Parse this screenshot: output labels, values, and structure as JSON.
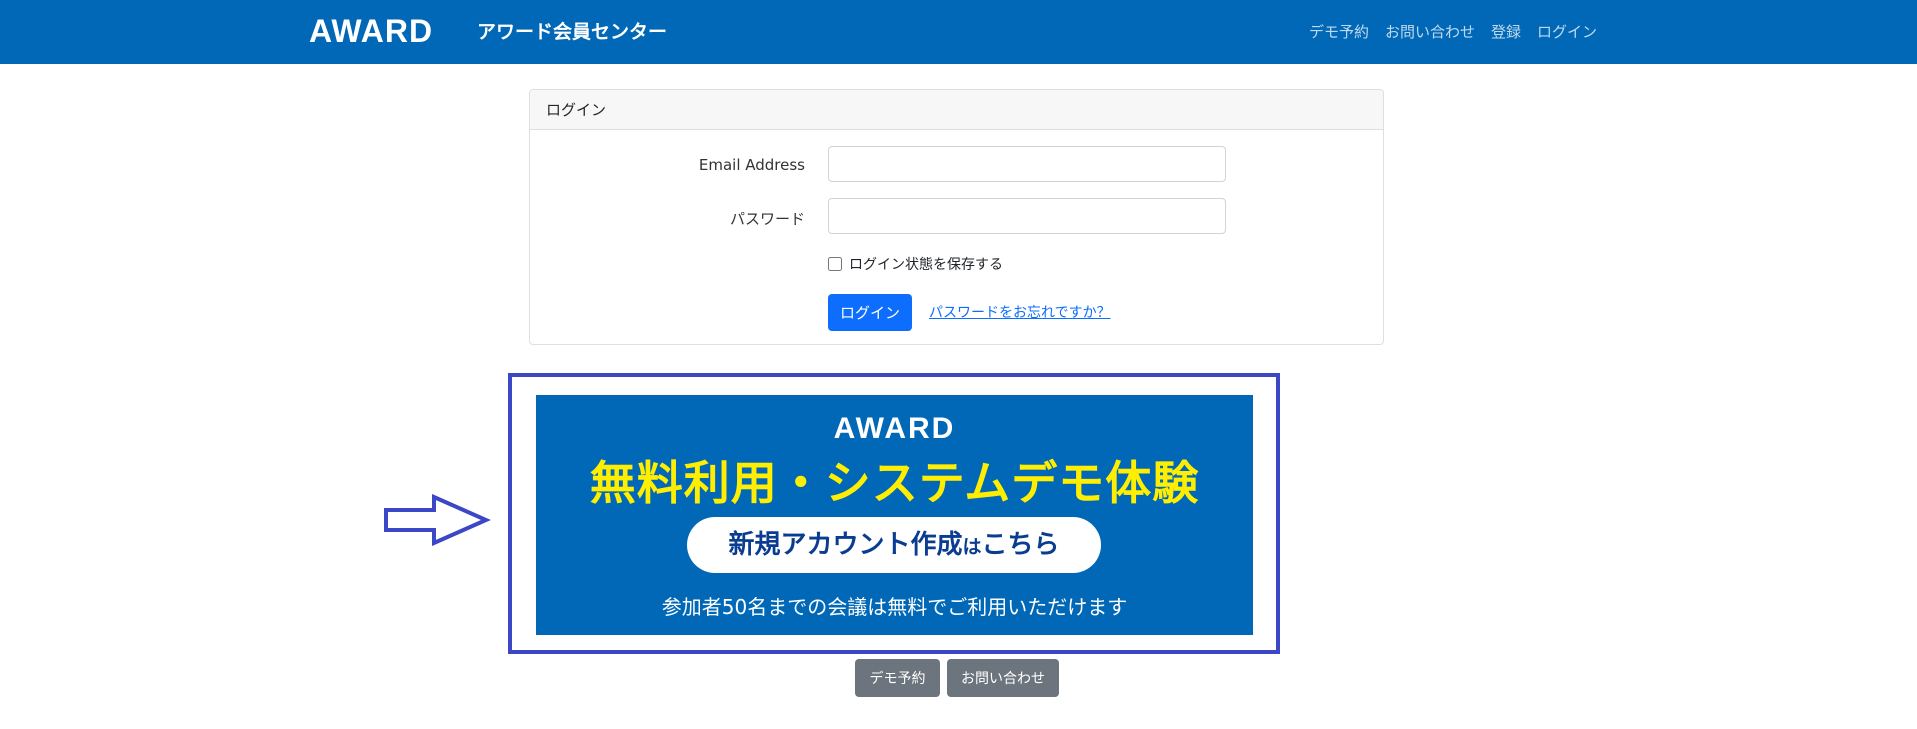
{
  "navbar": {
    "logo": "AWARD",
    "title": "アワード会員センター",
    "links": [
      "デモ予約",
      "お問い合わせ",
      "登録",
      "ログイン"
    ]
  },
  "login_card": {
    "header": "ログイン",
    "email_label": "Email Address",
    "email_value": "",
    "password_label": "パスワード",
    "password_value": "",
    "remember_label": "ログイン状態を保存する",
    "login_button": "ログイン",
    "forgot_link": "パスワードをお忘れですか？"
  },
  "banner": {
    "logo": "AWARD",
    "headline": "無料利用・システムデモ体験",
    "pill_main": "新規アカウント作成",
    "pill_small": "は",
    "pill_end": "こちら",
    "subtext": "参加者50名までの会議は無料でご利用いただけます"
  },
  "bottom_buttons": {
    "demo": "デモ予約",
    "contact": "お問い合わせ"
  },
  "colors": {
    "brand": "#0068b7",
    "primary": "#0d6efd",
    "highlight": "#ffee00",
    "frame": "#3b47c4",
    "secondary": "#6c757d"
  }
}
